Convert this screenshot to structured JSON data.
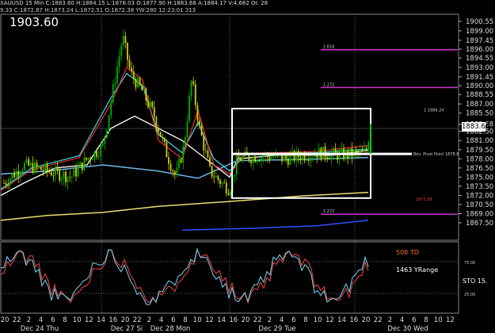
{
  "header": {
    "line1": "XAUUSD 15 Min  C:1883.60  H:1884.15  L:1876.03  O:1877.90  H:1883.68  A:1884.17  V:4,682  OI: 28",
    "line2": "9.33  C:1872.87  H:1873.24  L:1872.51  O:1872.38  YW:280  12:23:01  313"
  },
  "price_title": "1903.60",
  "price_axis": {
    "labels": [
      "1900.55",
      "1899.00",
      "1897.45",
      "1896.00",
      "1894.55",
      "1893.00",
      "1891.45",
      "1890.00",
      "1888.55",
      "1887.00",
      "1885.50",
      "1883.68",
      "1882.50",
      "1881.00",
      "1879.50",
      "1878.00",
      "1876.50",
      "1875.00",
      "1873.50",
      "1872.00",
      "1870.50",
      "1869.00",
      "1867.50"
    ],
    "last_price": "1883.68"
  },
  "fib_labels": {
    "f1618": "1.618",
    "f1272": "1.272",
    "f1": "1",
    "f1272b": "1.272",
    "box_top": "1886.24",
    "box_mid": "Rev. Pivot Point 1878.8",
    "box_bot": "1871.56"
  },
  "time_axis": {
    "hours": [
      "20",
      "22",
      "2",
      "4",
      "6",
      "8",
      "10",
      "12",
      "14",
      "16",
      "20",
      "22",
      "2",
      "4",
      "6",
      "8",
      "10",
      "12",
      "14",
      "16",
      "20",
      "22",
      "2",
      "4",
      "6",
      "8",
      "10",
      "12",
      "14",
      "16",
      "20",
      "22",
      "2",
      "4",
      "6",
      "8",
      "10",
      "12"
    ],
    "days": [
      "Dec 24 Thu",
      "Dec 27 Si",
      "Dec 28 Mon",
      "Dec 29 Tue",
      "Dec 30 Wed"
    ]
  },
  "indicator": {
    "td_text": "508 TD",
    "yrange_text": "1463 YRange",
    "sto_text": "STO 15.",
    "levels": [
      "25.00",
      "75.00"
    ]
  },
  "colors": {
    "fib_magenta": "#cc33cc",
    "candle_up": "#00b000",
    "candle_down": "#d0d000",
    "ema_cyan": "#3ad0e0",
    "ema_white": "#ffffff",
    "ema_red": "#ff3030",
    "ma_yellow": "#e8e070",
    "ma_blue": "#3050ff",
    "ma_lightblue": "#70b8e8",
    "td_orange": "#ff6a2a"
  }
}
